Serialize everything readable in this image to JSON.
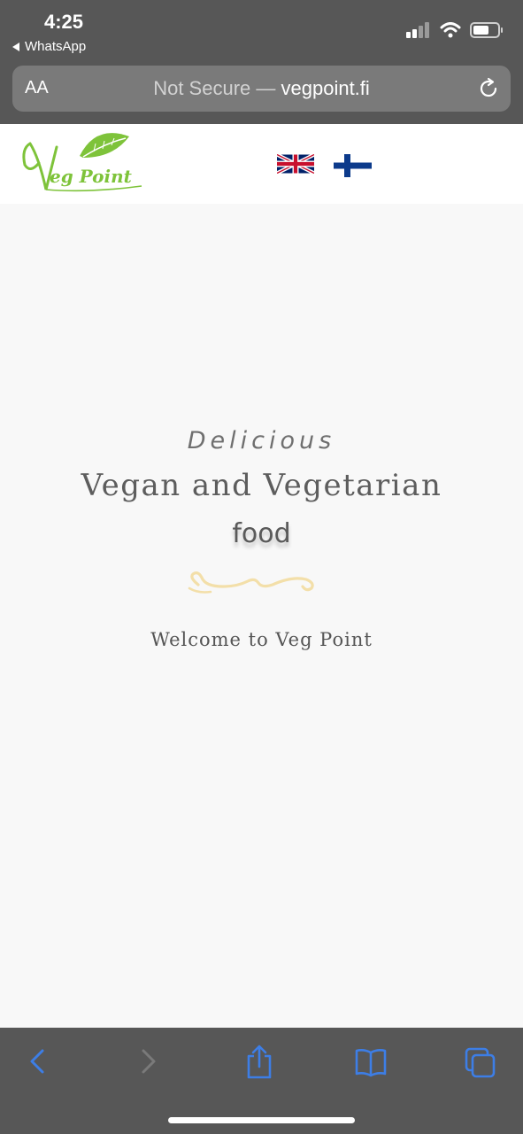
{
  "status_bar": {
    "time": "4:25",
    "back_app": "WhatsApp"
  },
  "address_bar": {
    "text_size_label": "AA",
    "security_label": "Not Secure —",
    "host": "vegpoint.fi"
  },
  "header": {
    "logo_text": "Veg Point",
    "languages": [
      "English",
      "Finnish"
    ]
  },
  "hero": {
    "line1": "Delicious",
    "line2": "Vegan and Vegetarian",
    "line3": "food",
    "welcome": "Welcome to Veg Point"
  },
  "colors": {
    "chrome": "#575757",
    "url_bar": "#7a7a7a",
    "logo_green": "#7ec33a",
    "toolbar_blue": "#3d7ee6",
    "swirl": "#f3dfa9"
  },
  "toolbar": {
    "icons": [
      "back-icon",
      "forward-icon",
      "share-icon",
      "bookmarks-icon",
      "tabs-icon"
    ]
  }
}
